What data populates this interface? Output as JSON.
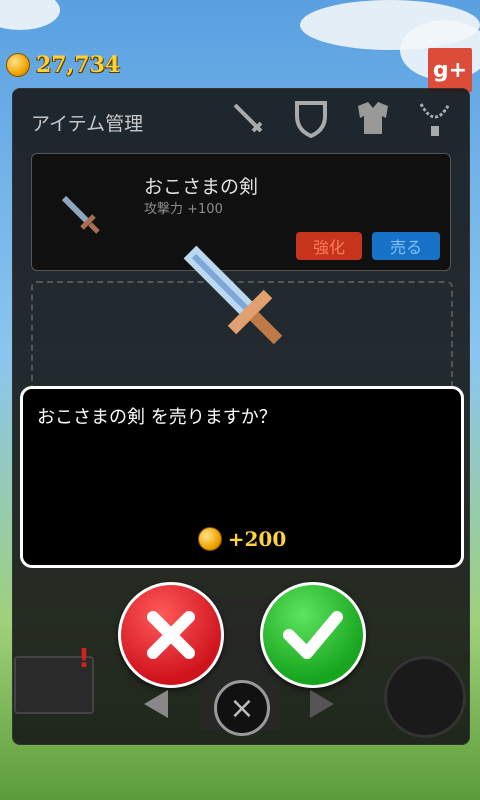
{
  "hud": {
    "gold": "27,734"
  },
  "gplus_label": "g+",
  "panel": {
    "title": "アイテム管理"
  },
  "tabs": [
    {
      "name": "weapon-tab",
      "icon": "sword-icon"
    },
    {
      "name": "shield-tab",
      "icon": "shield-icon"
    },
    {
      "name": "armor-tab",
      "icon": "armor-icon"
    },
    {
      "name": "accessory-tab",
      "icon": "necklace-icon"
    }
  ],
  "item": {
    "name": "おこさまの剣",
    "stat": "攻撃力 +100",
    "enhance_label": "強化",
    "sell_label": "売る"
  },
  "dialog": {
    "message": "おこさまの剣 を売りますか？",
    "price": "+200"
  },
  "colors": {
    "accent_gold": "#ffd23a",
    "enhance": "#c6341c",
    "sell": "#1873c8",
    "confirm": "#17a61e",
    "cancel": "#d0141e"
  }
}
